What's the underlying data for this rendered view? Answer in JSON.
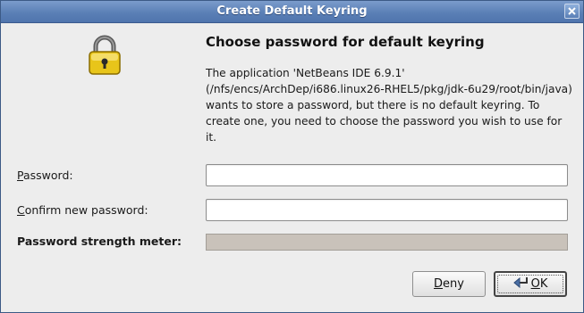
{
  "window": {
    "title": "Create Default Keyring"
  },
  "dialog": {
    "heading": "Choose password for default keyring",
    "description": "The application 'NetBeans IDE 6.9.1' (/nfs/encs/ArchDep/i686.linux26-RHEL5/pkg/jdk-6u29/root/bin/java) wants to store a password, but there is no default keyring. To create one, you need to choose the password you wish to use for it."
  },
  "form": {
    "password_label_mnemonic": "P",
    "password_label_rest": "assword:",
    "password_value": "",
    "confirm_label_mnemonic": "C",
    "confirm_label_rest": "onfirm new password:",
    "confirm_value": "",
    "strength_label": "Password strength meter:",
    "strength_level": 0
  },
  "buttons": {
    "deny_mnemonic": "D",
    "deny_rest": "eny",
    "ok_mnemonic": "O",
    "ok_rest": "K"
  },
  "icons": {
    "dialog_icon": "padlock-icon",
    "close_icon": "close-icon",
    "ok_icon": "enter-arrow-icon"
  },
  "colors": {
    "titlebar": "#5b80b6",
    "lock_gold": "#e8c51a",
    "meter_empty": "#c9c2ba"
  }
}
